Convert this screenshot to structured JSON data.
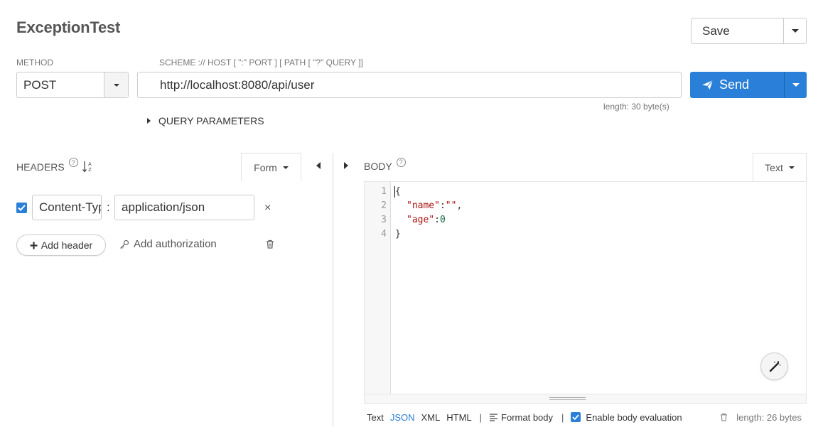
{
  "request": {
    "title": "ExceptionTest",
    "save_label": "Save",
    "method_label": "METHOD",
    "method_value": "POST",
    "url_format_label": "SCHEME :// HOST [ \":\" PORT ] [ PATH [ \"?\" QUERY ]]",
    "url_value": "http://localhost:8080/api/user",
    "url_length": "length: 30 byte(s)",
    "send_label": "Send",
    "query_params_label": "QUERY PARAMETERS"
  },
  "headers": {
    "title": "HEADERS",
    "mode": "Form",
    "items": [
      {
        "enabled": true,
        "key": "Content-Type",
        "value": "application/json"
      }
    ],
    "remove_glyph": "×",
    "add_header_label": "Add header",
    "add_authorization_label": "Add authorization"
  },
  "body": {
    "title": "BODY",
    "mode": "Text",
    "line_numbers": [
      "1",
      "2",
      "3",
      "4"
    ],
    "code": {
      "l1": "{",
      "l2_key": "\"name\"",
      "l2_colon": ":",
      "l2_val": "\"\"",
      "l2_comma": ",",
      "l3_key": "\"age\"",
      "l3_colon": ":",
      "l3_val": "0",
      "l4": "}"
    },
    "formats": [
      "Text",
      "JSON",
      "XML",
      "HTML"
    ],
    "active_format": "JSON",
    "separator": "|",
    "format_body_label": "Format body",
    "enable_eval_label": "Enable body evaluation",
    "enable_eval_checked": true,
    "length": "length: 26 bytes"
  },
  "colors": {
    "accent": "#2a7fd8",
    "border": "#cccccc",
    "muted_text": "#777777"
  },
  "icons": {
    "send": "paper-plane-icon",
    "sort": "sort-alpha-icon",
    "help": "help-circle-icon",
    "key": "key-icon",
    "trash": "trash-icon",
    "magic": "magic-wand-icon",
    "format": "align-left-icon"
  }
}
